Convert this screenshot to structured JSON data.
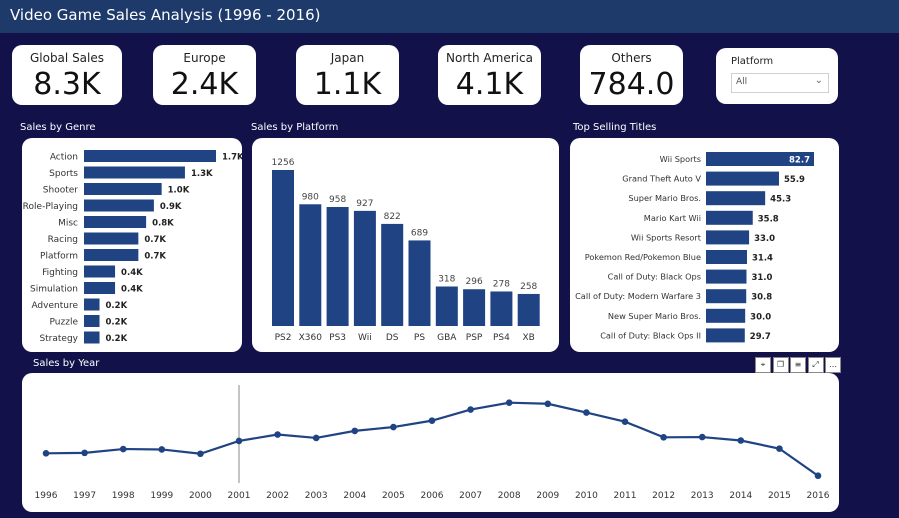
{
  "header": {
    "title": "Video Game Sales Analysis (1996 -  2016)"
  },
  "kpis": [
    {
      "label": "Global Sales",
      "value": "8.3K"
    },
    {
      "label": "Europe",
      "value": "2.4K"
    },
    {
      "label": "Japan",
      "value": "1.1K"
    },
    {
      "label": "North America",
      "value": "4.1K"
    },
    {
      "label": "Others",
      "value": "784.0"
    }
  ],
  "slicer": {
    "title": "Platform",
    "value": "All"
  },
  "sections": {
    "genre": "Sales by Genre",
    "platform": "Sales by Platform",
    "titles": "Top Selling Titles",
    "year": "Sales by Year"
  },
  "visual_toolbar": [
    "pin-icon",
    "copy-icon",
    "filter-icon",
    "focus-mode-icon",
    "more-options-icon"
  ],
  "colors": {
    "bar": "#1f4383",
    "background": "#12114a",
    "header": "#1d3a6b"
  },
  "chart_data": [
    {
      "type": "bar",
      "orientation": "horizontal",
      "title": "Sales by Genre",
      "categories": [
        "Action",
        "Sports",
        "Shooter",
        "Role-Playing",
        "Misc",
        "Racing",
        "Platform",
        "Fighting",
        "Simulation",
        "Adventure",
        "Puzzle",
        "Strategy"
      ],
      "values": [
        1700,
        1300,
        1000,
        900,
        800,
        700,
        700,
        400,
        400,
        200,
        200,
        200
      ],
      "labels": [
        "1.7K",
        "1.3K",
        "1.0K",
        "0.9K",
        "0.8K",
        "0.7K",
        "0.7K",
        "0.4K",
        "0.4K",
        "0.2K",
        "0.2K",
        "0.2K"
      ]
    },
    {
      "type": "bar",
      "orientation": "vertical",
      "title": "Sales by Platform",
      "categories": [
        "PS2",
        "X360",
        "PS3",
        "Wii",
        "DS",
        "PS",
        "GBA",
        "PSP",
        "PS4",
        "XB"
      ],
      "values": [
        1256,
        980,
        958,
        927,
        822,
        689,
        318,
        296,
        278,
        258
      ],
      "labels": [
        "1256",
        "980",
        "958",
        "927",
        "822",
        "689",
        "318",
        "296",
        "278",
        "258"
      ]
    },
    {
      "type": "bar",
      "orientation": "horizontal",
      "title": "Top Selling Titles",
      "categories": [
        "Wii Sports",
        "Grand Theft Auto V",
        "Super Mario Bros.",
        "Mario Kart Wii",
        "Wii Sports Resort",
        "Pokemon Red/Pokemon Blue",
        "Call of Duty: Black Ops",
        "Call of Duty: Modern Warfare 3",
        "New Super Mario Bros.",
        "Call of Duty: Black Ops II"
      ],
      "values": [
        82.7,
        55.9,
        45.3,
        35.8,
        33.0,
        31.4,
        31.0,
        30.8,
        30.0,
        29.7
      ],
      "labels": [
        "82.7",
        "55.9",
        "45.3",
        "35.8",
        "33.0",
        "31.4",
        "31.0",
        "30.8",
        "30.0",
        "29.7"
      ]
    },
    {
      "type": "line",
      "title": "Sales by Year",
      "x": [
        "1996",
        "1997",
        "1998",
        "1999",
        "2000",
        "2001",
        "2002",
        "2003",
        "2004",
        "2005",
        "2006",
        "2007",
        "2008",
        "2009",
        "2010",
        "2011",
        "2012",
        "2013",
        "2014",
        "2015",
        "2016"
      ],
      "values": [
        195,
        197,
        215,
        213,
        193,
        253,
        283,
        267,
        300,
        318,
        348,
        400,
        432,
        427,
        386,
        343,
        270,
        271,
        255,
        217,
        90
      ],
      "ylim": [
        70,
        440
      ],
      "highlight_x": "2001"
    }
  ]
}
